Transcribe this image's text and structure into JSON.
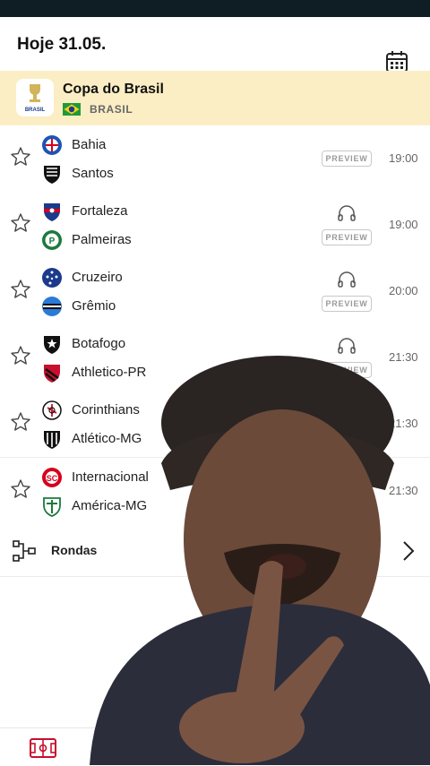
{
  "header": {
    "title": "Hoje 31.05.",
    "calendar_icon": "calendar-icon"
  },
  "league": {
    "name": "Copa do Brasil",
    "country": "BRASIL",
    "logo_text": "BRASIL",
    "flag_colors": [
      "#1e9a3c",
      "#f7d117",
      "#1b3a8c"
    ]
  },
  "preview_label": "PREVIEW",
  "matches": [
    {
      "home": "Bahia",
      "away": "Santos",
      "time": "19:00",
      "audio": false
    },
    {
      "home": "Fortaleza",
      "away": "Palmeiras",
      "time": "19:00",
      "audio": true
    },
    {
      "home": "Cruzeiro",
      "away": "Grêmio",
      "time": "20:00",
      "audio": true
    },
    {
      "home": "Botafogo",
      "away": "Athletico-PR",
      "time": "21:30",
      "audio": true
    },
    {
      "home": "Corinthians",
      "away": "Atlético-MG",
      "time": "21:30",
      "audio": false
    },
    {
      "home": "Internacional",
      "away": "América-MG",
      "time": "21:30",
      "audio": false
    }
  ],
  "rondas": {
    "label": "Rondas"
  },
  "bottom_nav": {
    "icon": "football-pitch-icon"
  },
  "colors": {
    "accent": "#c8102e",
    "league_bg": "#fbeec4",
    "statusbar": "#0f1d24"
  }
}
